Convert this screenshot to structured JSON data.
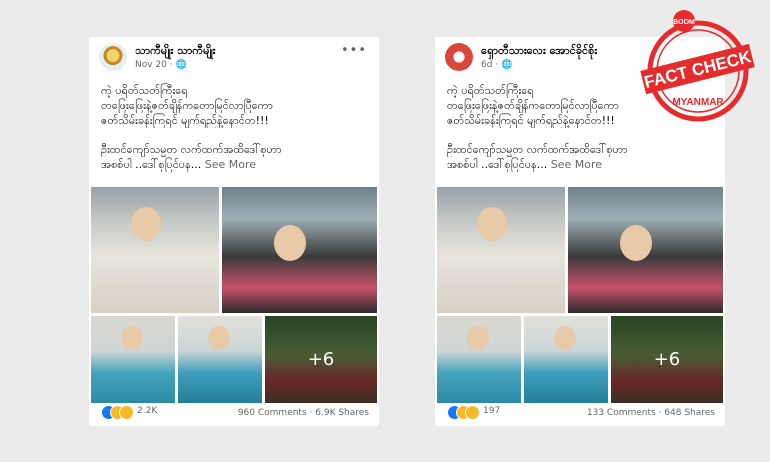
{
  "posts": [
    {
      "name": "သာကီမျိုး သာကီမျိုး",
      "meta": "Nov 20 · 🌐",
      "line1": "ကဲ့ ပရိတ်သတ်ကြီးရေ",
      "line2": "တဖြေးဖြေးနဲ့ဇတ်ချိန်ကတောမြင်လာပြီကော",
      "line3": "ဇတ်သိမ်းခန်းကြရင် မျက်ရည်နဲ့နောင်တ!!!",
      "line4": "ဦးထင်ကျော်သမ္မတ လက်ထက်အထိဒေါ်စုဟာ",
      "line5": "အစစ်ပါ ..ဒေါ်စုပြင်ပန...",
      "see_more": "See More",
      "photo_more": "+6",
      "reaction_count": "2.2K",
      "comments": "960 Comments",
      "shares": "6.9K Shares"
    },
    {
      "name": "ရှောတီသားလေး အောင်ခိုင်စိုး",
      "meta": "6d · 🌐",
      "line1": "ကဲ့ ပရိတ်သတ်ကြီးရေ",
      "line2": "တဖြေးဖြေးနဲ့ဇတ်ချိန်ကတောမြင်လာပြီကော",
      "line3": "ဇတ်သိမ်းခန်းကြရင် မျက်ရည်နဲ့နောင်တ!!!",
      "line4": "ဦးထင်ကျော်သမ္မတ လက်ထက်အထိဒေါ်စုဟာ",
      "line5": "အစစ်ပါ ..ဒေါ်စုပြင်ပန...",
      "see_more": "See More",
      "photo_more": "+6",
      "reaction_count": "197",
      "comments": "133 Comments",
      "shares": "648 Shares"
    }
  ],
  "badge": {
    "top": "BOOM",
    "main": "FACT CHECK",
    "bottom": "MYANMAR",
    "color": "#e52b2b"
  }
}
